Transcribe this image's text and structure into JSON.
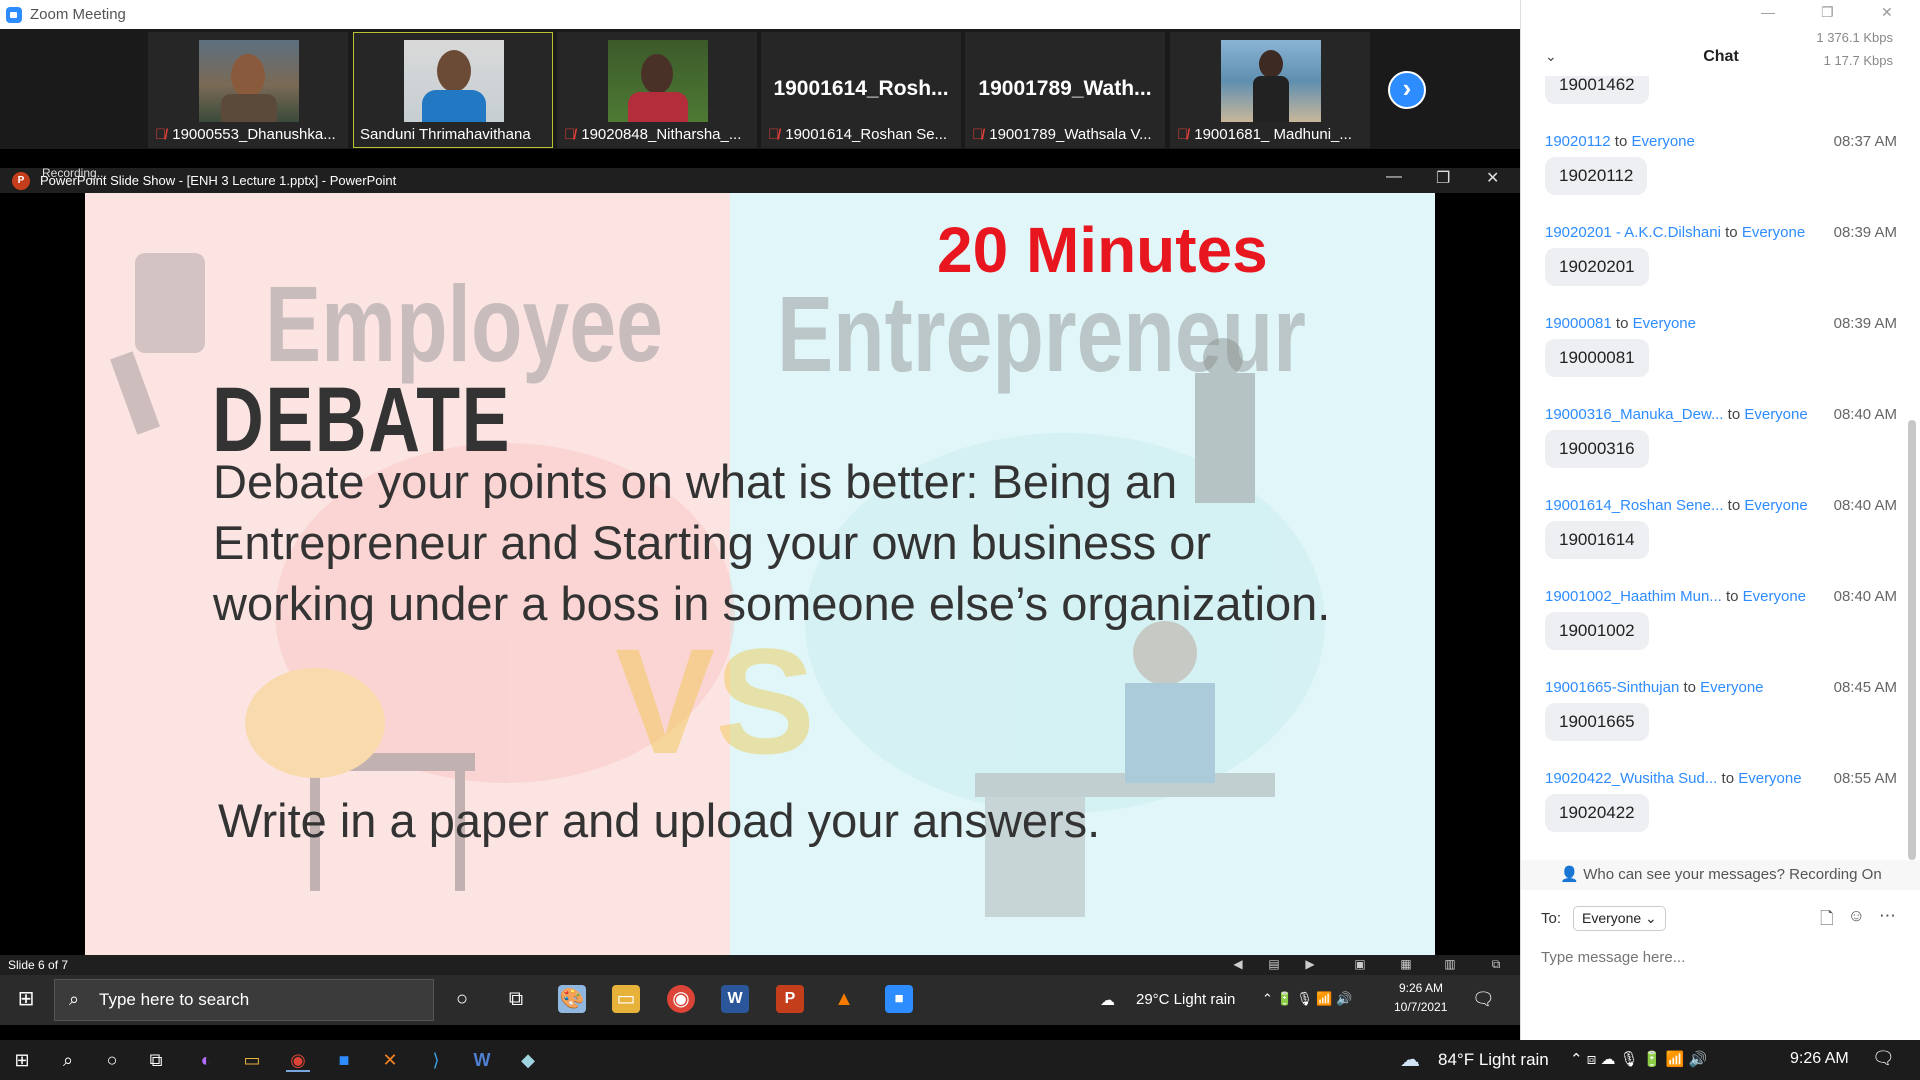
{
  "zoom": {
    "window_title": "Zoom Meeting",
    "participants": [
      {
        "name": "19000553_Dhanushka...",
        "muted": true,
        "has_video": true
      },
      {
        "name": "Sanduni Thrimahavithana",
        "muted": false,
        "has_video": true,
        "active": true
      },
      {
        "name": "19020848_Nitharsha_...",
        "muted": true,
        "has_video": true
      },
      {
        "name": "19001614_Roshan Se...",
        "display": "19001614_Rosh...",
        "muted": true,
        "has_video": false
      },
      {
        "name": "19001789_Wathsala V...",
        "display": "19001789_Wath...",
        "muted": true,
        "has_video": false
      },
      {
        "name": "19001681_ Madhuni_...",
        "muted": true,
        "has_video": true
      }
    ],
    "next_icon": "chevron-right-icon"
  },
  "ppt": {
    "recording_label": "Recording...",
    "title": "PowerPoint Slide Show - [ENH 3 Lecture 1.pptx] - PowerPoint",
    "slide_status": "Slide 6 of 7"
  },
  "slide": {
    "timer": "20 Minutes",
    "watermark_left": "Employee",
    "watermark_right": "Entrepreneur",
    "watermark_vs": "VS",
    "heading": "DEBATE",
    "body": "Debate your points on what is better: Being an Entrepreneur and Starting your own business or working under a boss in someone else’s organization.",
    "instruction": "Write in a paper and upload your answers.",
    "colors": {
      "left_bg": "#fce4e3",
      "right_bg": "#e0f6f8",
      "timer": "#e8171f"
    }
  },
  "inner_taskbar": {
    "search_placeholder": "Type here to search",
    "weather": "29°C  Light rain",
    "time": "9:26 AM",
    "date": "10/7/2021"
  },
  "outer_taskbar": {
    "weather": "84°F  Light rain",
    "time": "9:26 AM"
  },
  "chat": {
    "title": "Chat",
    "stats": [
      "1 376.1 Kbps",
      "1 17.7 Kbps"
    ],
    "partial_top": "19001462",
    "messages": [
      {
        "sender": "19020112",
        "to": "to",
        "recipient": "Everyone",
        "time": "08:37 AM",
        "text": "19020112"
      },
      {
        "sender": "19020201 - A.K.C.Dilshani",
        "to": "to",
        "recipient": "Everyone",
        "time": "08:39 AM",
        "text": "19020201"
      },
      {
        "sender": "19000081",
        "to": "to",
        "recipient": "Everyone",
        "time": "08:39 AM",
        "text": "19000081"
      },
      {
        "sender": "19000316_Manuka_Dew...",
        "to": "to",
        "recipient": "Everyone",
        "time": "08:40 AM",
        "text": "19000316"
      },
      {
        "sender": "19001614_Roshan Sene...",
        "to": "to",
        "recipient": "Everyone",
        "time": "08:40 AM",
        "text": "19001614"
      },
      {
        "sender": "19001002_Haathim Mun...",
        "to": "to",
        "recipient": "Everyone",
        "time": "08:40 AM",
        "text": "19001002"
      },
      {
        "sender": "19001665-Sinthujan",
        "to": "to",
        "recipient": "Everyone",
        "time": "08:45 AM",
        "text": "19001665"
      },
      {
        "sender": "19020422_Wusitha Sud...",
        "to": "to",
        "recipient": "Everyone",
        "time": "08:55 AM",
        "text": "19020422"
      }
    ],
    "visibility_note": "Who can see your messages? Recording On",
    "to_label": "To:",
    "to_value": "Everyone",
    "composer_placeholder": "Type message here..."
  }
}
